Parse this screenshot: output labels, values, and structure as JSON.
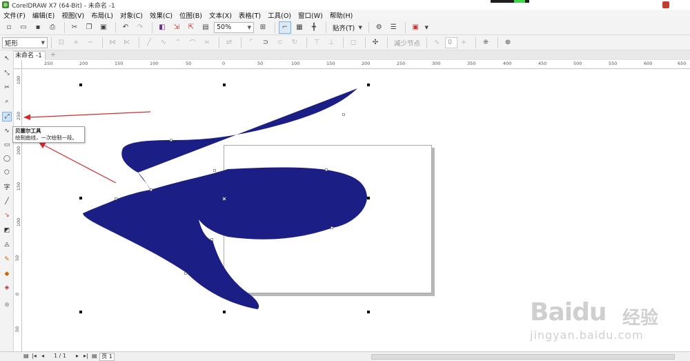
{
  "window": {
    "title": "CorelDRAW X7 (64-Bit) - 未命名 -1"
  },
  "menu": [
    "文件(F)",
    "编辑(E)",
    "视图(V)",
    "布局(L)",
    "对象(C)",
    "效果(C)",
    "位图(B)",
    "文本(X)",
    "表格(T)",
    "工具(O)",
    "窗口(W)",
    "帮助(H)"
  ],
  "toolbar": {
    "zoom_value": "50%",
    "snap_label": "贴齐(T)"
  },
  "property_bar": {
    "shape_select": "矩形",
    "reduce_nodes_label": "减少节点",
    "smoothness_value": "0"
  },
  "document_tab": {
    "label": "未命名 -1"
  },
  "ruler": {
    "h_labels": [
      "250",
      "200",
      "150",
      "100",
      "50",
      "0",
      "50",
      "100",
      "150",
      "200",
      "250",
      "300",
      "350",
      "400",
      "450",
      "500",
      "550",
      "600",
      "650"
    ],
    "v_labels": [
      "100",
      "250",
      "200",
      "150",
      "100",
      "50",
      "0",
      "50"
    ]
  },
  "tooltip": {
    "title": "贝塞尔工具",
    "description": "绘制曲线，一次绘制一段。"
  },
  "status": {
    "page_count": "1 / 1",
    "page_tab": "页 1"
  },
  "watermark": {
    "brand": "Baidu",
    "cn": "经验",
    "url": "jingyan.baidu.com"
  },
  "colors": {
    "shape_fill": "#1b1e84",
    "arrow": "#d42a2a",
    "canvas": "#ffffff"
  },
  "icons": [
    "new-icon",
    "open-icon",
    "save-icon",
    "print-icon",
    "cut-icon",
    "copy-icon",
    "paste-icon",
    "undo-icon",
    "redo-icon",
    "import-icon",
    "export-icon",
    "zoom-icon",
    "pick-tool-icon",
    "bezier-tool-icon",
    "text-tool-icon"
  ]
}
